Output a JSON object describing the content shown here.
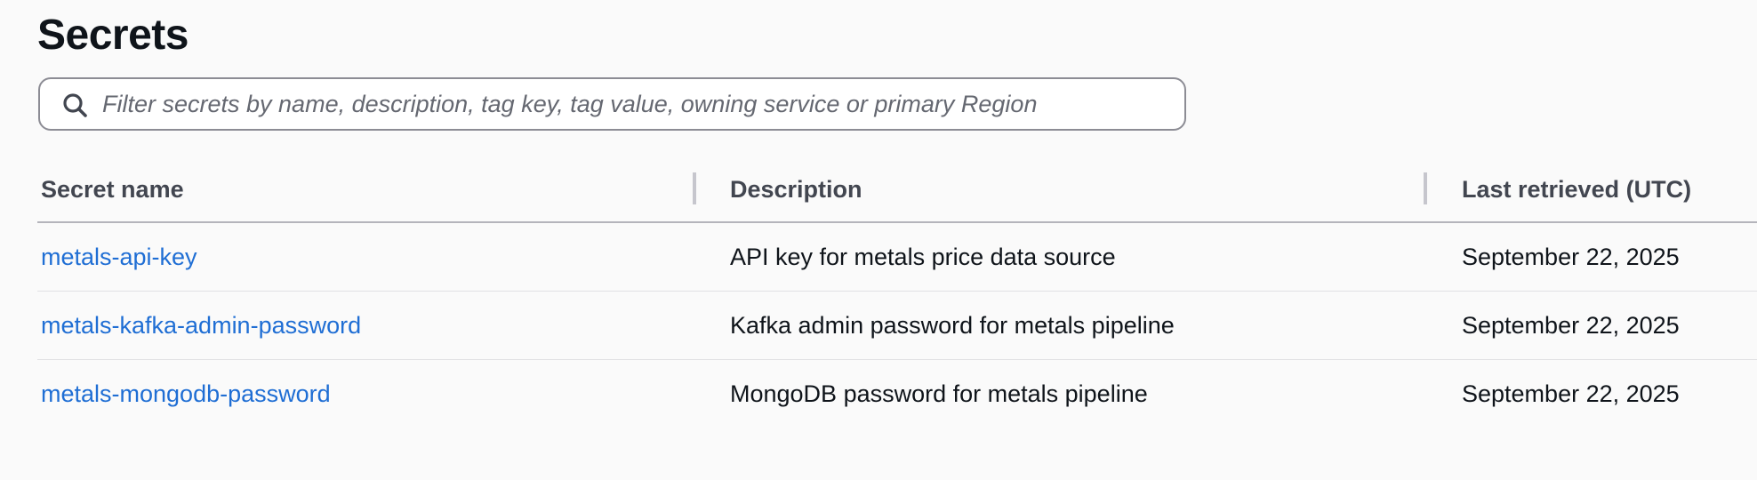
{
  "header": {
    "title": "Secrets"
  },
  "search": {
    "placeholder": "Filter secrets by name, description, tag key, tag value, owning service or primary Region",
    "value": ""
  },
  "table": {
    "columns": [
      "Secret name",
      "Description",
      "Last retrieved (UTC)"
    ],
    "rows": [
      {
        "name": "metals-api-key",
        "description": "API key for metals price data source",
        "last_retrieved": "September 22, 2025"
      },
      {
        "name": "metals-kafka-admin-password",
        "description": "Kafka admin password for metals pipeline",
        "last_retrieved": "September 22, 2025"
      },
      {
        "name": "metals-mongodb-password",
        "description": "MongoDB password for metals pipeline",
        "last_retrieved": "September 22, 2025"
      }
    ]
  },
  "colors": {
    "link": "#1f6ed4",
    "text": "#0f141a",
    "header_text": "#424650",
    "border": "#8c8c94",
    "background": "#fafafa"
  }
}
